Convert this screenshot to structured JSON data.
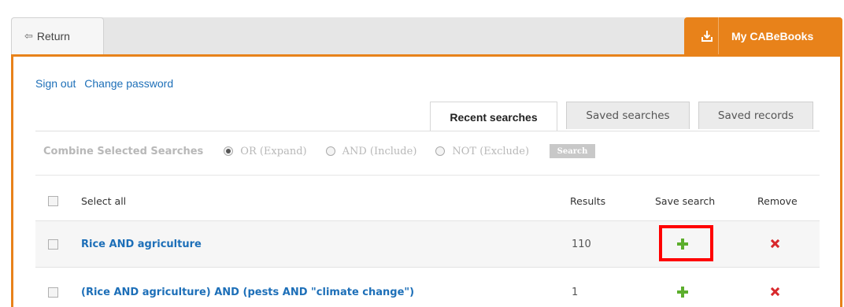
{
  "topbar": {
    "return_label": "Return",
    "return_icon": "arrow-left-icon",
    "mybooks_label": "My CABeBooks",
    "mybooks_icon": "download-icon",
    "accent_color": "#e8821a"
  },
  "account": {
    "sign_out": "Sign out",
    "change_password": "Change password"
  },
  "tabs": [
    {
      "label": "Recent searches",
      "active": true
    },
    {
      "label": "Saved searches",
      "active": false
    },
    {
      "label": "Saved records",
      "active": false
    }
  ],
  "combine": {
    "label": "Combine Selected Searches",
    "options": [
      {
        "label": "OR (Expand)",
        "selected": true
      },
      {
        "label": "AND (Include)",
        "selected": false
      },
      {
        "label": "NOT (Exclude)",
        "selected": false
      }
    ],
    "search_button": "Search"
  },
  "table": {
    "headers": {
      "select_all": "Select all",
      "results": "Results",
      "save_search": "Save search",
      "remove": "Remove"
    },
    "rows": [
      {
        "query": "Rice AND agriculture",
        "results": "110",
        "save_icon": "plus-icon",
        "remove_icon": "close-icon"
      },
      {
        "query": "(Rice AND agriculture) AND (pests AND \"climate change\")",
        "results": "1",
        "save_icon": "plus-icon",
        "remove_icon": "close-icon"
      }
    ]
  },
  "highlight_color": "#ff0000"
}
